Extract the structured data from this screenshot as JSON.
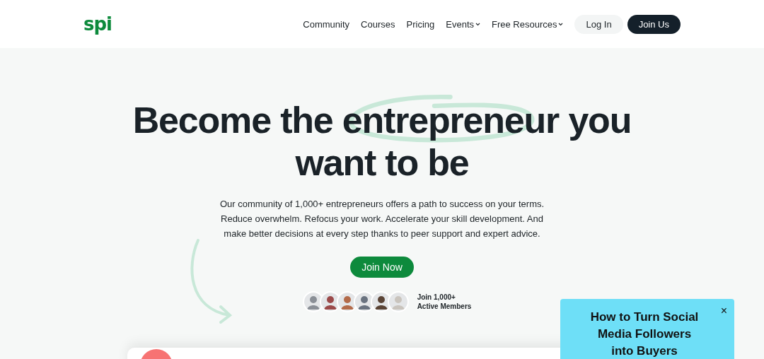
{
  "header": {
    "logo": "spi",
    "nav": [
      {
        "label": "Community",
        "dropdown": false
      },
      {
        "label": "Courses",
        "dropdown": false
      },
      {
        "label": "Pricing",
        "dropdown": false
      },
      {
        "label": "Events",
        "dropdown": true
      },
      {
        "label": "Free Resources",
        "dropdown": true
      }
    ],
    "login": "Log In",
    "join": "Join Us"
  },
  "hero": {
    "title_lines": [
      "Become the entrepreneur you",
      "want to be"
    ],
    "text": "Our community of 1,000+ entrepreneurs offers a path to success on your terms. Reduce overwhelm. Refocus your work. Accelerate your skill development. And make better decisions at every step thanks to peer support and expert advice.",
    "cta": "Join Now",
    "avatars": [
      {
        "color": "#8a8f96"
      },
      {
        "color": "#9b4a4a"
      },
      {
        "color": "#b36b4a"
      },
      {
        "color": "#6a7380"
      },
      {
        "color": "#5a4436"
      },
      {
        "color": "#c9c4bd"
      }
    ],
    "members": [
      "Join 1,000+",
      "Active Members"
    ]
  },
  "popup": {
    "title": "How to Turn Social Media Followers into Buyers",
    "close": "×"
  }
}
